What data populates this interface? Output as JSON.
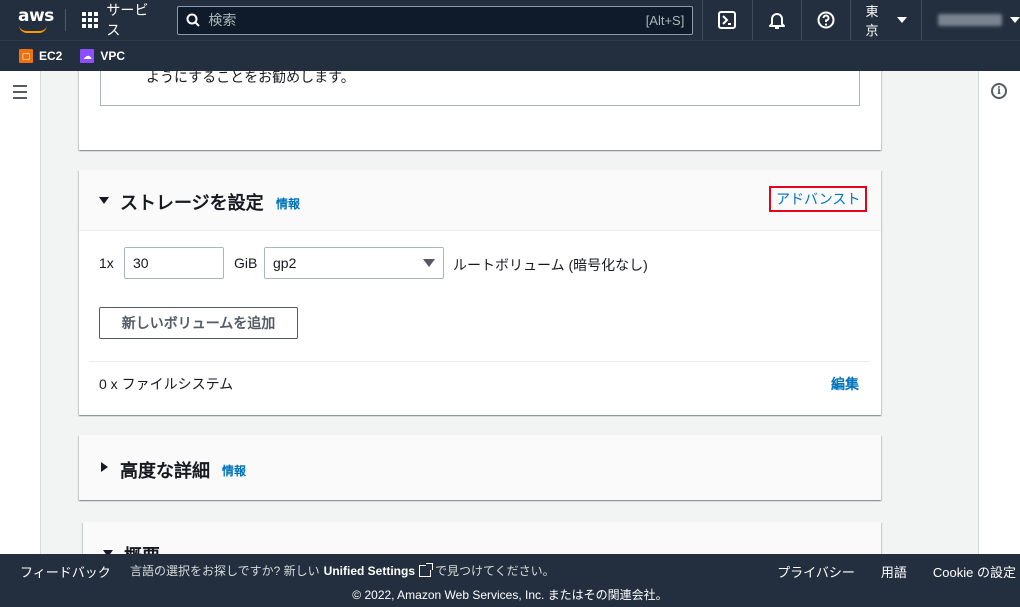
{
  "nav": {
    "logo_text": "aws",
    "services_label": "サービス",
    "search_placeholder": "検索",
    "search_shortcut": "[Alt+S]",
    "region_label": "東京"
  },
  "favorites": [
    {
      "label": "EC2",
      "color": "#ec7211"
    },
    {
      "label": "VPC",
      "color": "#8c4fff"
    }
  ],
  "card_top": {
    "notice_text": "ようにすることをお勧めします。"
  },
  "storage": {
    "title": "ストレージを設定",
    "info_label": "情報",
    "advanced_label": "アドバンスト",
    "count_label": "1x",
    "size_value": "30",
    "size_unit": "GiB",
    "volume_type": "gp2",
    "volume_desc": "ルートボリューム (暗号化なし)",
    "add_volume_label": "新しいボリュームを追加",
    "filesystem_label": "0 x ファイルシステム",
    "edit_label": "編集"
  },
  "advanced_details": {
    "title": "高度な詳細",
    "info_label": "情報"
  },
  "summary": {
    "title": "概要"
  },
  "footer": {
    "feedback_label": "フィードバック",
    "lang_prefix": "言語の選択をお探しですか? 新しい",
    "unified_settings": "Unified Settings",
    "lang_suffix": "で見つけてください。",
    "privacy_label": "プライバシー",
    "terms_label": "用語",
    "cookie_label": "Cookie の設定",
    "copyright": "© 2022, Amazon Web Services, Inc. またはその関連会社。"
  },
  "colors": {
    "nav_bg": "#232f3e",
    "link": "#0073bb",
    "highlight_border": "#e0061b",
    "accent": "#ff9900"
  }
}
